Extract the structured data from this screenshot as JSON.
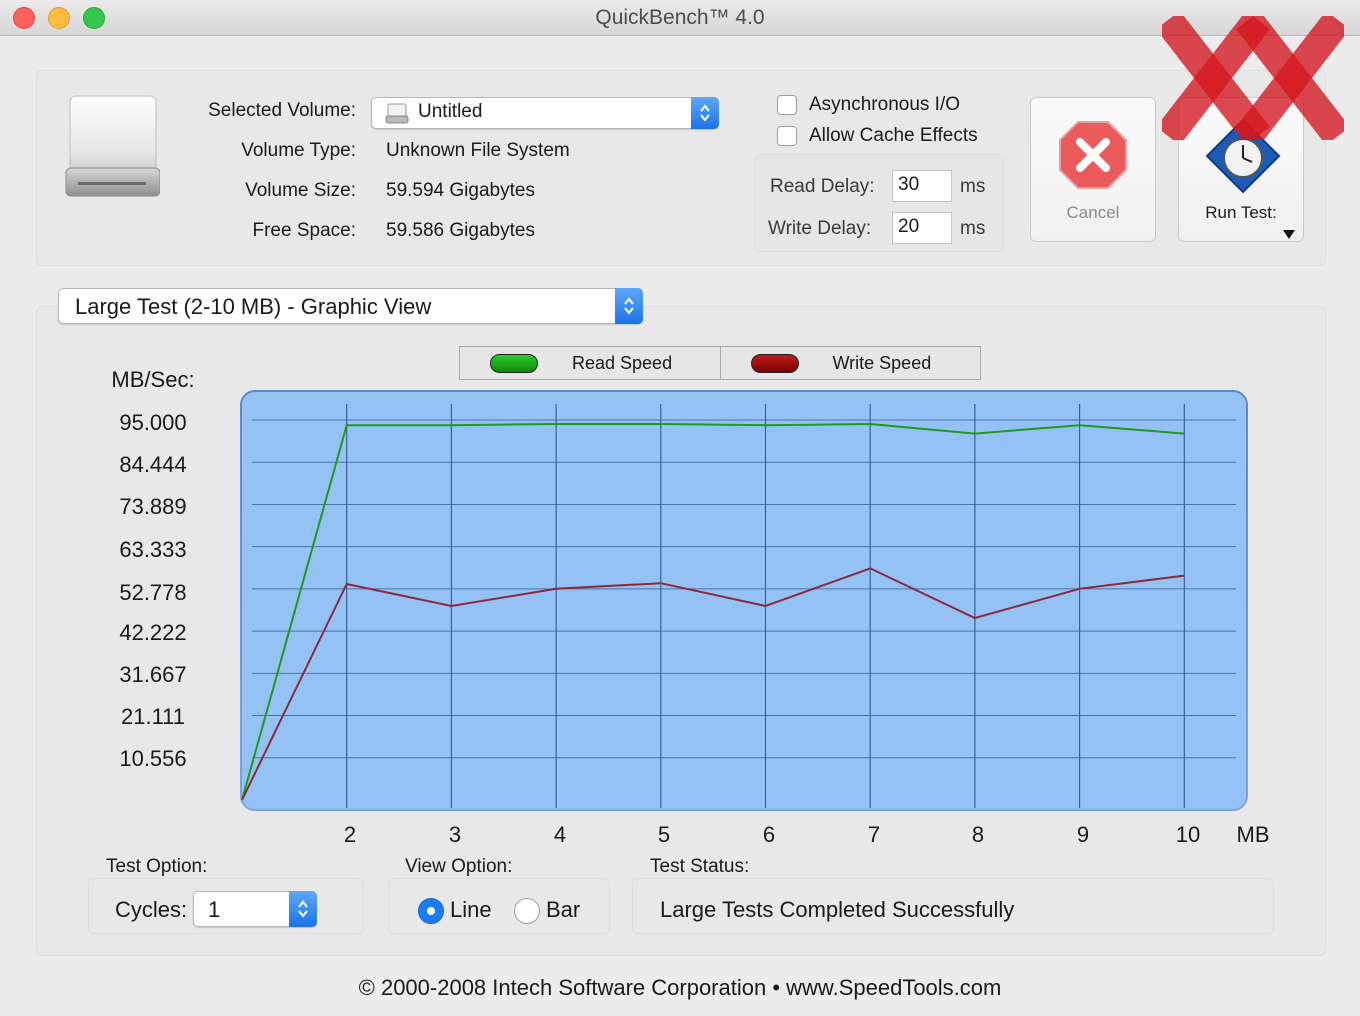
{
  "window": {
    "title": "QuickBench™ 4.0"
  },
  "volume": {
    "selected_label": "Selected Volume:",
    "selected_value": "Untitled",
    "type_label": "Volume Type:",
    "type_value": "Unknown File System",
    "size_label": "Volume Size:",
    "size_value": "59.594 Gigabytes",
    "free_label": "Free Space:",
    "free_value": "59.586 Gigabytes"
  },
  "options": {
    "async_io": {
      "label": "Asynchronous I/O",
      "checked": false
    },
    "cache_effects": {
      "label": "Allow Cache Effects",
      "checked": false
    },
    "read_delay_label": "Read Delay:",
    "read_delay_value": "30",
    "write_delay_label": "Write Delay:",
    "write_delay_value": "20",
    "unit": "ms"
  },
  "buttons": {
    "cancel": "Cancel",
    "run_test": "Run Test:"
  },
  "view_selector": {
    "value": "Large Test (2-10 MB) - Graphic View"
  },
  "legend": [
    {
      "label": "Read Speed",
      "color": "#0a8a0a"
    },
    {
      "label": "Write Speed",
      "color": "#8b0000"
    }
  ],
  "chart_data": {
    "type": "line",
    "ylabel": "MB/Sec:",
    "xlabel": "MB",
    "y_ticks": [
      "95.000",
      "84.444",
      "73.889",
      "63.333",
      "52.778",
      "42.222",
      "31.667",
      "21.111",
      "10.556"
    ],
    "ylim": [
      0,
      100
    ],
    "x_ticks": [
      "2",
      "3",
      "4",
      "5",
      "6",
      "7",
      "8",
      "9",
      "10"
    ],
    "x": [
      1,
      2,
      3,
      4,
      5,
      6,
      7,
      8,
      9,
      10
    ],
    "grid": true,
    "series": [
      {
        "name": "Read Speed",
        "color": "#1f9a1f",
        "values": [
          0,
          93.7,
          93.7,
          94.0,
          94.0,
          93.7,
          94.0,
          91.6,
          93.7,
          91.6
        ]
      },
      {
        "name": "Write Speed",
        "color": "#8a2a3a",
        "values": [
          0,
          54.0,
          48.5,
          52.8,
          54.2,
          48.5,
          57.9,
          45.5,
          52.8,
          56.1
        ]
      }
    ]
  },
  "bottom": {
    "test_option_label": "Test Option:",
    "cycles_label": "Cycles:",
    "cycles_value": "1",
    "view_option_label": "View Option:",
    "view_line": "Line",
    "view_bar": "Bar",
    "view_selected": "Line",
    "test_status_label": "Test Status:",
    "test_status_value": "Large Tests Completed Successfully"
  },
  "footer": {
    "text": "© 2000-2008 Intech Software Corporation • www.SpeedTools.com"
  }
}
